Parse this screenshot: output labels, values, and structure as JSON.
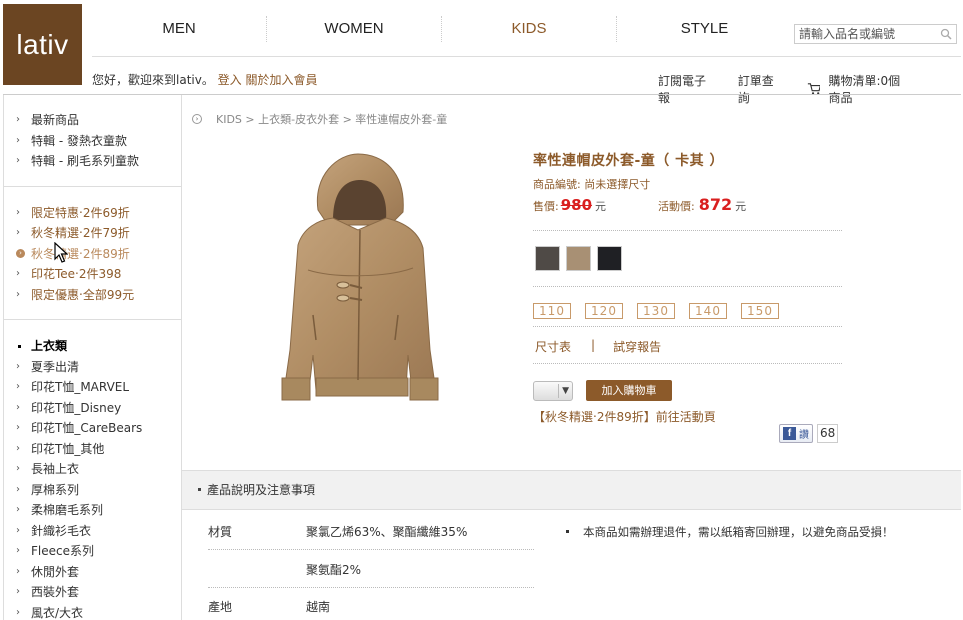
{
  "brand": {
    "logo_text": "lativ",
    "color": "#6b4522"
  },
  "nav": {
    "items": [
      {
        "label": "MEN"
      },
      {
        "label": "WOMEN"
      },
      {
        "label": "KIDS"
      },
      {
        "label": "STYLE"
      }
    ],
    "active": "KIDS"
  },
  "search": {
    "placeholder": "請輸入品名或編號"
  },
  "welcome": {
    "text": "您好，歡迎來到lativ。",
    "login": "登入",
    "join": "關於加入會員"
  },
  "toplinks": {
    "newsletter": "訂閱電子報",
    "order": "訂單查詢",
    "cart": "購物清單:0個商品"
  },
  "sidebar": {
    "group1": [
      "最新商品",
      "特輯 - 發熱衣童款",
      "特輯 - 刷毛系列童款"
    ],
    "group2": [
      "限定特惠‧2件69折",
      "秋冬精選‧2件79折",
      "秋冬精選‧2件89折",
      "印花Tee‧2件398",
      "限定優惠‧全部99元"
    ],
    "group3_header": "上衣類",
    "group3": [
      "夏季出清",
      "印花T恤_MARVEL",
      "印花T恤_Disney",
      "印花T恤_CareBears",
      "印花T恤_其他",
      "長袖上衣",
      "厚棉系列",
      "柔棉磨毛系列",
      "針織衫毛衣",
      "Fleece系列",
      "休閒外套",
      "西裝外套",
      "風衣/大衣"
    ]
  },
  "breadcrumb": {
    "text": "KIDS > 上衣類-皮衣外套 > 率性連帽皮外套-童"
  },
  "product": {
    "title": "率性連帽皮外套-童（ 卡其 ）",
    "code": "商品編號: 尚未選擇尺寸",
    "price_label": "售價:",
    "original_price": "980",
    "currency": "元",
    "sale_label": "活動價:",
    "sale_price": "872",
    "swatches": [
      {
        "name": "gray",
        "color": "#4f4a46"
      },
      {
        "name": "khaki",
        "color": "#a89074"
      },
      {
        "name": "black",
        "color": "#1f2024"
      }
    ],
    "sizes": [
      "110",
      "120",
      "130",
      "140",
      "150"
    ],
    "size_chart": "尺寸表",
    "separator": "|",
    "trial_report": "試穿報告",
    "add_to_cart": "加入購物車",
    "promo": "【秋冬精選‧2件89折】前往活動頁",
    "fb_like": "讚",
    "fb_count": "68"
  },
  "details": {
    "header": "產品說明及注意事項",
    "specs": [
      {
        "key": "材質",
        "value": "聚氯乙烯63%、聚酯纖維35%"
      },
      {
        "key": "",
        "value": "聚氨酯2%"
      },
      {
        "key": "產地",
        "value": "越南"
      }
    ],
    "note": "本商品如需辦理退件，需以紙箱寄回辦理，以避免商品受損！"
  }
}
